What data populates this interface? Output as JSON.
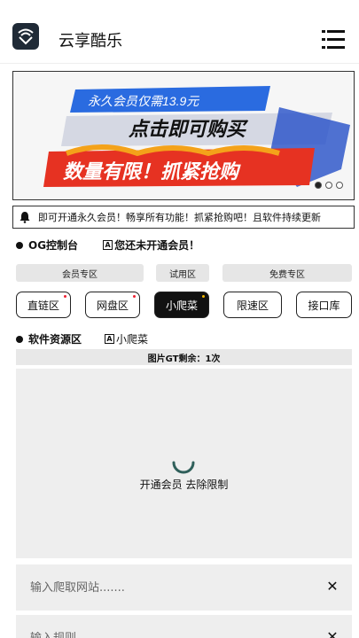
{
  "app": {
    "title": "云享酷乐",
    "logo_icon": "wifi-logo-icon",
    "menu_icon": "hamburger-menu-icon"
  },
  "banner": {
    "line1": "永久会员仅需13.9元",
    "line2": "点击即可购买",
    "line3": "数量有限！抓紧抢购",
    "slides": 3,
    "active_slide": 0,
    "colors": {
      "blue": "#2a6be0",
      "red": "#e63222",
      "orange": "#f4a21a"
    }
  },
  "notice": {
    "icon": "bell-icon",
    "text": "即可开通永久会员！畅享所有功能！抓紧抢购吧！且软件持续更新"
  },
  "console": {
    "title": "OG控制台",
    "status": "您还未开通会员！",
    "status_icon": "A"
  },
  "categories": [
    {
      "label": "会员专区"
    },
    {
      "label": "试用区"
    },
    {
      "label": "免费专区"
    }
  ],
  "zones": [
    {
      "label": "直链区",
      "badge": "red"
    },
    {
      "label": "网盘区",
      "badge": "red"
    },
    {
      "label": "小爬菜",
      "badge": "yellow",
      "active": true
    },
    {
      "label": "限速区"
    },
    {
      "label": "接口库"
    }
  ],
  "resource": {
    "title": "软件资源区",
    "current": "小爬菜",
    "current_icon": "A"
  },
  "gt": {
    "text": "图片GT剩余：1次"
  },
  "viewer": {
    "label": "开通会员 去除限制"
  },
  "inputs": {
    "site_placeholder": "输入爬取网站.......",
    "rule_placeholder": "输入规则"
  }
}
